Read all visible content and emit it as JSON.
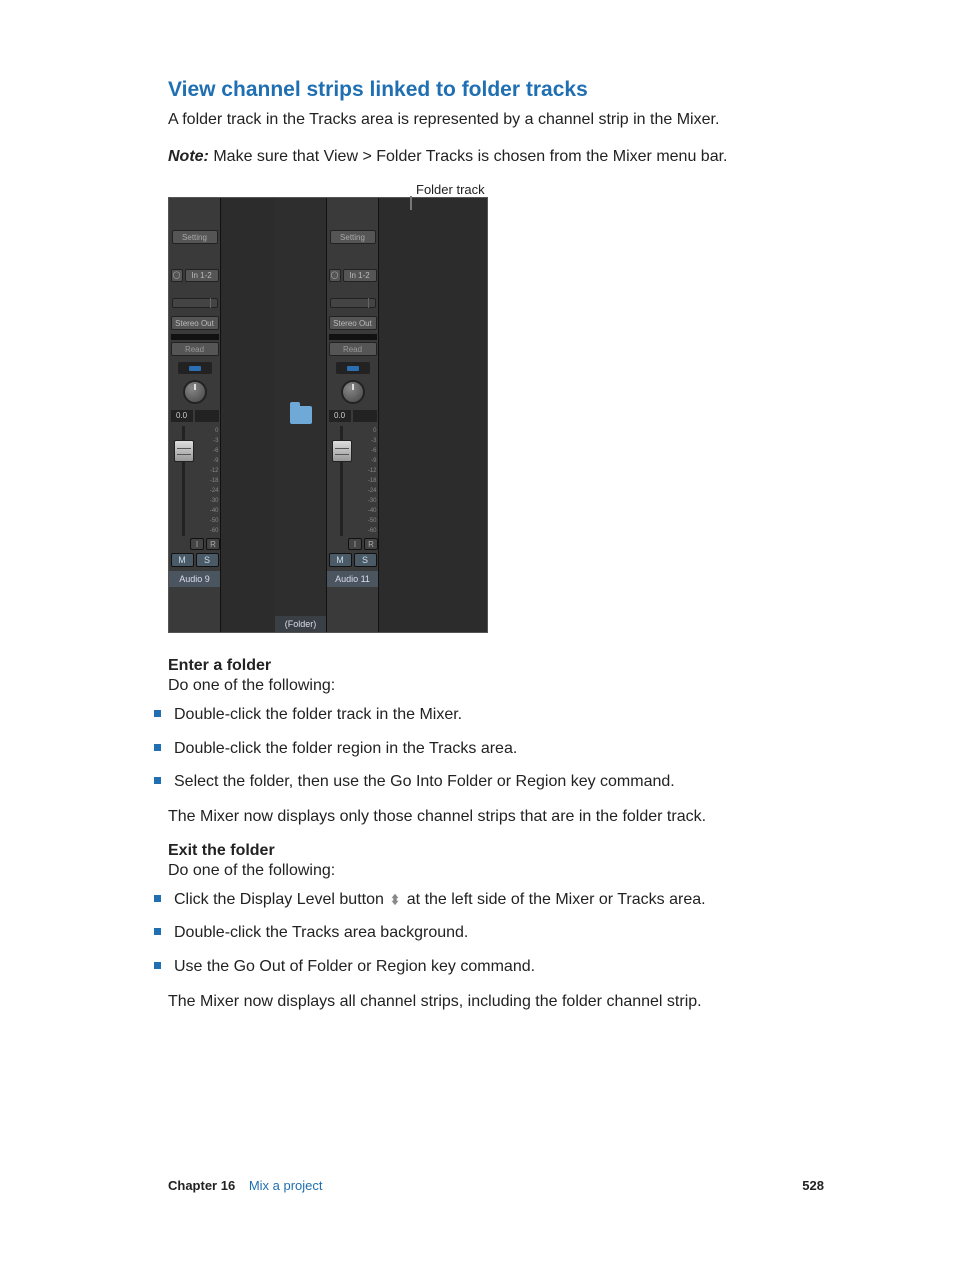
{
  "heading": "View channel strips linked to folder tracks",
  "intro": "A folder track in the Tracks area is represented by a channel strip in the Mixer.",
  "note_label": "Note:",
  "note_body": "  Make sure that View > Folder Tracks is chosen from the Mixer menu bar.",
  "figure": {
    "callout": "Folder track",
    "strip_a": {
      "setting": "Setting",
      "input_icon": "◯",
      "input": "In 1-2",
      "output": "Stereo Out",
      "read": "Read",
      "db": "0.0",
      "i": "I",
      "r": "R",
      "m": "M",
      "s": "S",
      "name": "Audio 9",
      "scale": [
        "0",
        "-3",
        "-6",
        "-9",
        "-12",
        "-18",
        "-24",
        "-30",
        "-40",
        "-50",
        "-60"
      ]
    },
    "folder_strip": {
      "name": "(Folder)"
    },
    "strip_b": {
      "setting": "Setting",
      "input_icon": "◯",
      "input": "In 1-2",
      "output": "Stereo Out",
      "read": "Read",
      "db": "0.0",
      "i": "I",
      "r": "R",
      "m": "M",
      "s": "S",
      "name": "Audio 11",
      "scale": [
        "0",
        "-3",
        "-6",
        "-9",
        "-12",
        "-18",
        "-24",
        "-30",
        "-40",
        "-50",
        "-60"
      ]
    }
  },
  "enter": {
    "title": "Enter a folder",
    "lead": "Do one of the following:",
    "items": [
      "Double-click the folder track in the Mixer.",
      "Double-click the folder region in the Tracks area.",
      "Select the folder, then use the Go Into Folder or Region key command."
    ],
    "after": "The Mixer now displays only those channel strips that are in the folder track."
  },
  "exit": {
    "title": "Exit the folder",
    "lead": "Do one of the following:",
    "item1_pre": "Click the Display Level button ",
    "item1_post": " at the left side of the Mixer or Tracks area.",
    "items_rest": [
      "Double-click the Tracks area background.",
      "Use the Go Out of Folder or Region key command."
    ],
    "after": "The Mixer now displays all channel strips, including the folder channel strip."
  },
  "footer": {
    "chapter_label": "Chapter  16",
    "chapter_title": "Mix a project",
    "page": "528"
  }
}
